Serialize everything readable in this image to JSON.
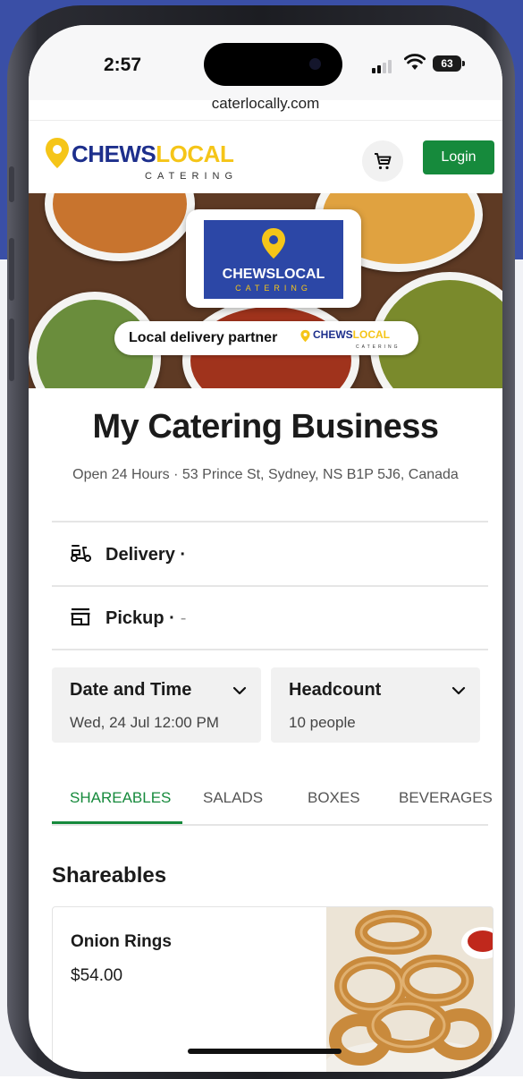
{
  "status_bar": {
    "time": "2:57",
    "battery": "63"
  },
  "browser": {
    "url": "caterlocally.com"
  },
  "header": {
    "logo_main_1": "CHEWS",
    "logo_main_2": "LOCAL",
    "logo_sub": "CATERING",
    "cart_icon": "cart-icon",
    "login_label": "Login"
  },
  "hero": {
    "badge_title": "CHEWSLOCAL",
    "badge_sub": "CATERING",
    "partner_label": "Local delivery partner",
    "partner_logo_1": "CHEWS",
    "partner_logo_2": "LOCAL",
    "partner_logo_sub": "CATERING"
  },
  "business": {
    "name": "My Catering Business",
    "info": "Open 24 Hours · 53 Prince St, Sydney, NS B1P 5J6, Canada"
  },
  "options": [
    {
      "label": "Delivery ·",
      "extra": "",
      "icon": "scooter-icon"
    },
    {
      "label": "Pickup ·",
      "extra": "-",
      "icon": "store-icon"
    }
  ],
  "selectors": {
    "date": {
      "label": "Date and Time",
      "value": "Wed, 24 Jul 12:00 PM"
    },
    "headcount": {
      "label": "Headcount",
      "value": "10 people"
    }
  },
  "tabs": [
    "SHAREABLES",
    "SALADS",
    "BOXES",
    "BEVERAGES"
  ],
  "active_tab": "SHAREABLES",
  "section": {
    "title": "Shareables"
  },
  "products": [
    {
      "name": "Onion Rings",
      "price": "$54.00"
    }
  ],
  "colors": {
    "brand_blue": "#1d2f8c",
    "brand_yellow": "#f5c518",
    "accent_green": "#168a3c",
    "backdrop_blue": "#3a4fa6"
  }
}
